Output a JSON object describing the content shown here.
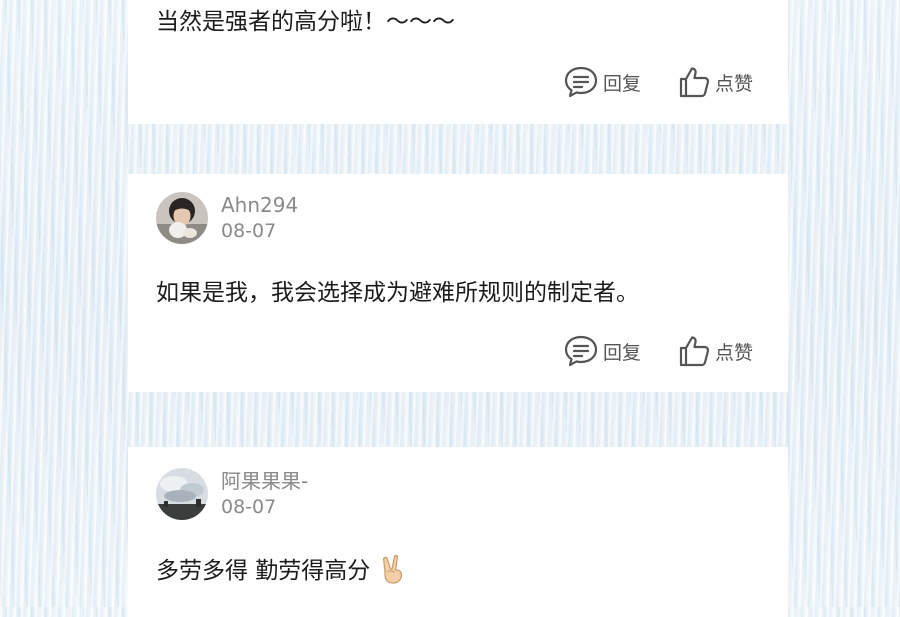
{
  "comments": [
    {
      "content": "当然是强者的高分啦！～～～",
      "reply_label": "回复",
      "like_label": "点赞"
    },
    {
      "username": "Ahn294",
      "date": "08-07",
      "content": "如果是我，我会选择成为避难所规则的制定者。",
      "reply_label": "回复",
      "like_label": "点赞"
    },
    {
      "username": "阿果果果-",
      "date": "08-07",
      "content": "多劳多得 勤劳得高分",
      "emoji": "victory-hand-icon"
    }
  ],
  "icons": {
    "reply": "comment-bubble-icon",
    "like": "thumbs-up-icon"
  },
  "colors": {
    "text": "#1c1c1c",
    "meta": "#8a8a8a",
    "action": "#555555",
    "card": "#ffffff",
    "background": "#e9f2f8"
  }
}
